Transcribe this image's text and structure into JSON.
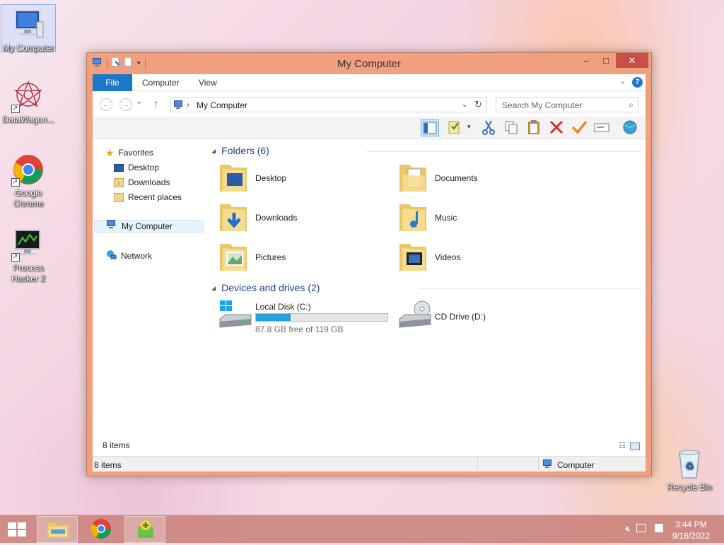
{
  "desktop": {
    "icons": [
      {
        "label": "My Computer",
        "icon": "computer-icon"
      },
      {
        "label": "DataWagon...",
        "icon": "datawagon-icon"
      },
      {
        "label": "Google Chrome",
        "icon": "chrome-icon"
      },
      {
        "label": "Process Hacker 2",
        "icon": "process-hacker-icon"
      },
      {
        "label": "Recycle Bin",
        "icon": "recycle-bin-icon"
      }
    ]
  },
  "window": {
    "title": "My Computer",
    "controls": {
      "minimize": "–",
      "maximize": "□",
      "close": "✕"
    },
    "ribbon_tabs": [
      "File",
      "Computer",
      "View"
    ],
    "address": {
      "path": "My Computer",
      "separator": "›"
    },
    "search": {
      "placeholder": "Search My Computer"
    },
    "nav": {
      "favorites_label": "Favorites",
      "favorites": [
        "Desktop",
        "Downloads",
        "Recent places"
      ],
      "computer_label": "My Computer",
      "network_label": "Network"
    },
    "folders": {
      "header": "Folders (6)",
      "items": [
        {
          "name": "Desktop",
          "icon": "desktop-folder-icon"
        },
        {
          "name": "Documents",
          "icon": "documents-folder-icon"
        },
        {
          "name": "Downloads",
          "icon": "downloads-folder-icon"
        },
        {
          "name": "Music",
          "icon": "music-folder-icon"
        },
        {
          "name": "Pictures",
          "icon": "pictures-folder-icon"
        },
        {
          "name": "Videos",
          "icon": "videos-folder-icon"
        }
      ]
    },
    "drives": {
      "header": "Devices and drives (2)",
      "items": [
        {
          "name": "Local Disk (C:)",
          "free_text": "87.8 GB free of 119 GB",
          "used_fraction": 0.262
        },
        {
          "name": "CD Drive (D:)"
        }
      ]
    },
    "item_count": "8 items",
    "status": {
      "left": "8 items",
      "right": "Computer"
    }
  },
  "taskbar": {
    "time": "3:44 PM",
    "date": "9/16/2022"
  },
  "colors": {
    "accent": "#1979ca",
    "window_frame": "#f0a07e",
    "progress": "#26a0da",
    "close_button": "#c7504a"
  }
}
